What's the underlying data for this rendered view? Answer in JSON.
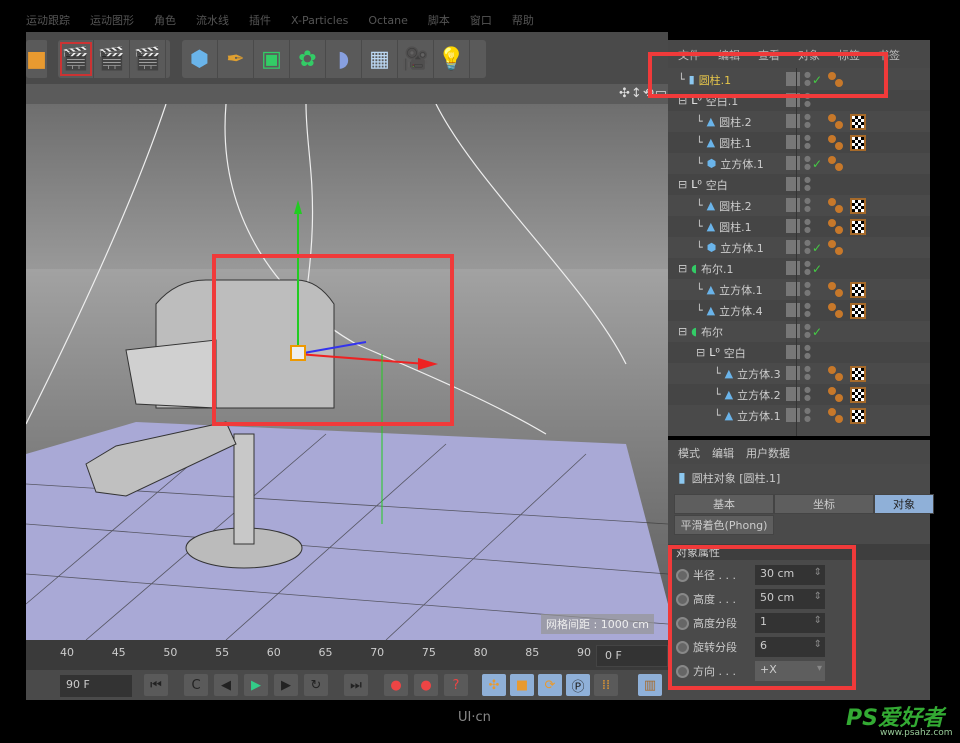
{
  "menubar": [
    "运动跟踪",
    "运动图形",
    "角色",
    "流水线",
    "插件",
    "X-Particles",
    "Octane",
    "脚本",
    "窗口",
    "帮助"
  ],
  "toolbar": {
    "icons": [
      "cube-object-icon",
      "render-view-icon",
      "render-picture-icon",
      "render-settings-icon",
      "cube-primitive-icon",
      "pen-spline-icon",
      "subdivision-icon",
      "mograph-cloner-icon",
      "deformer-icon",
      "floor-environment-icon",
      "camera-icon",
      "light-icon"
    ]
  },
  "viewport": {
    "grid_label": "网格间距 : 1000 cm",
    "nav_icons": "✣↕⟲▭"
  },
  "timeline": {
    "ticks": [
      "40",
      "45",
      "50",
      "55",
      "60",
      "65",
      "70",
      "75",
      "80",
      "85",
      "90"
    ],
    "current_frame": "0 F",
    "end_frame": "90 F"
  },
  "object_manager": {
    "menu": [
      "文件",
      "编辑",
      "查看",
      "对象",
      "标签",
      "书签"
    ],
    "rows": [
      {
        "name": "圆柱.1",
        "depth": 0,
        "icon": "cylinder",
        "check": true,
        "tags": [
          "phong"
        ],
        "selected": true
      },
      {
        "name": "空白.1",
        "depth": 0,
        "icon": "null",
        "check": false,
        "tags": []
      },
      {
        "name": "圆柱.2",
        "depth": 1,
        "icon": "polygon",
        "check": false,
        "tags": [
          "phong",
          "checker"
        ]
      },
      {
        "name": "圆柱.1",
        "depth": 1,
        "icon": "polygon",
        "check": false,
        "tags": [
          "phong",
          "checker"
        ]
      },
      {
        "name": "立方体.1",
        "depth": 1,
        "icon": "cube",
        "check": true,
        "tags": [
          "phong"
        ]
      },
      {
        "name": "空白",
        "depth": 0,
        "icon": "null",
        "check": false,
        "tags": []
      },
      {
        "name": "圆柱.2",
        "depth": 1,
        "icon": "polygon",
        "check": false,
        "tags": [
          "phong",
          "checker"
        ]
      },
      {
        "name": "圆柱.1",
        "depth": 1,
        "icon": "polygon",
        "check": false,
        "tags": [
          "phong",
          "checker"
        ]
      },
      {
        "name": "立方体.1",
        "depth": 1,
        "icon": "cube",
        "check": true,
        "tags": [
          "phong"
        ]
      },
      {
        "name": "布尔.1",
        "depth": 0,
        "icon": "boole",
        "check": true,
        "tags": []
      },
      {
        "name": "立方体.1",
        "depth": 1,
        "icon": "polygon",
        "check": false,
        "tags": [
          "phong",
          "checker"
        ]
      },
      {
        "name": "立方体.4",
        "depth": 1,
        "icon": "polygon",
        "check": false,
        "tags": [
          "phong",
          "checker"
        ]
      },
      {
        "name": "布尔",
        "depth": 0,
        "icon": "boole",
        "check": true,
        "tags": []
      },
      {
        "name": "空白",
        "depth": 1,
        "icon": "null",
        "check": false,
        "tags": []
      },
      {
        "name": "立方体.3",
        "depth": 2,
        "icon": "polygon",
        "check": false,
        "tags": [
          "phong",
          "checker"
        ]
      },
      {
        "name": "立方体.2",
        "depth": 2,
        "icon": "polygon",
        "check": false,
        "tags": [
          "phong",
          "checker"
        ]
      },
      {
        "name": "立方体.1",
        "depth": 2,
        "icon": "polygon",
        "check": false,
        "tags": [
          "phong",
          "checker"
        ]
      }
    ]
  },
  "attribute_manager": {
    "menu": [
      "模式",
      "编辑",
      "用户数据"
    ],
    "object_title": "圆柱对象 [圆柱.1]",
    "tabs": [
      "基本",
      "坐标",
      "对象"
    ],
    "active_tab": "对象",
    "phong_tab": "平滑着色(Phong)",
    "section": "对象属性",
    "props": [
      {
        "label": "半径 . . .",
        "value": "30 cm",
        "type": "number"
      },
      {
        "label": "高度 . . .",
        "value": "50 cm",
        "type": "number"
      },
      {
        "label": "高度分段",
        "value": "1",
        "type": "number"
      },
      {
        "label": "旋转分段",
        "value": "6",
        "type": "number"
      },
      {
        "label": "方向 . . .",
        "value": "+X",
        "type": "dropdown"
      }
    ]
  },
  "colors": {
    "highlight": "#f03a3a",
    "selected_text": "#e8c84a",
    "active_tab": "#8fb0d8",
    "floor": "#a9a9d6"
  },
  "watermark": "UI·cn",
  "ps_logo": "PS爱好者",
  "ps_site": "www.psahz.com"
}
